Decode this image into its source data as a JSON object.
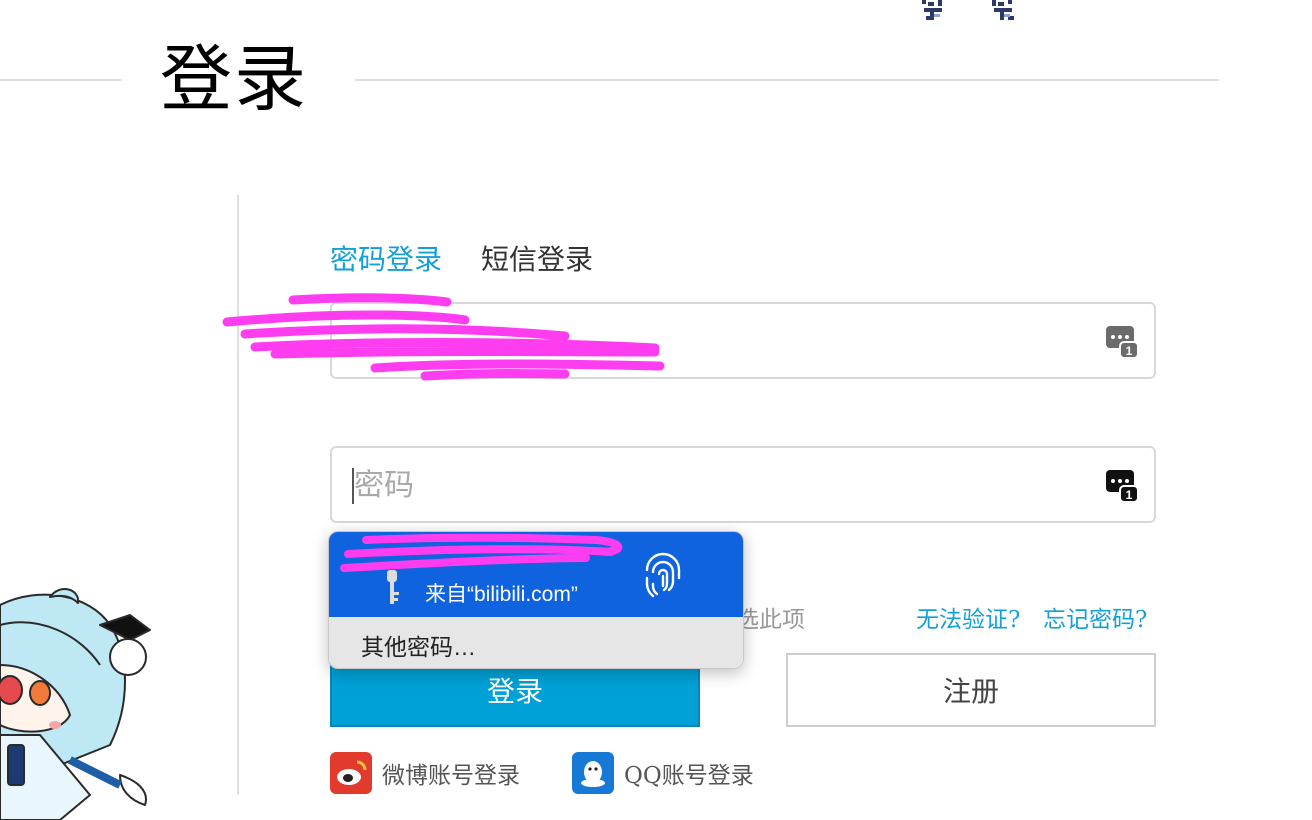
{
  "header": {
    "title": "登录"
  },
  "tabs": [
    {
      "label": "密码登录",
      "active": true
    },
    {
      "label": "短信登录",
      "active": false
    }
  ],
  "username": {
    "value": "",
    "icon": "password-key-icon",
    "badge": "1"
  },
  "password": {
    "placeholder": "密码",
    "value": "",
    "icon": "password-key-icon",
    "badge": "1"
  },
  "autofill": {
    "source": "来自“bilibili.com”",
    "other": "其他密码…",
    "icons": [
      "key-icon",
      "fingerprint-icon"
    ]
  },
  "options": {
    "remember_partial": "选此项",
    "cannot_verify": "无法验证?",
    "forgot": "忘记密码?"
  },
  "buttons": {
    "login": "登录",
    "register": "注册"
  },
  "social": [
    {
      "label": "微博账号登录",
      "icon": "weibo-icon"
    },
    {
      "label": "QQ账号登录",
      "icon": "qq-icon"
    }
  ],
  "colors": {
    "accent": "#00a1d6",
    "link": "#13a0d8",
    "popup": "#0f63de",
    "redaction": "#ff3df0"
  }
}
